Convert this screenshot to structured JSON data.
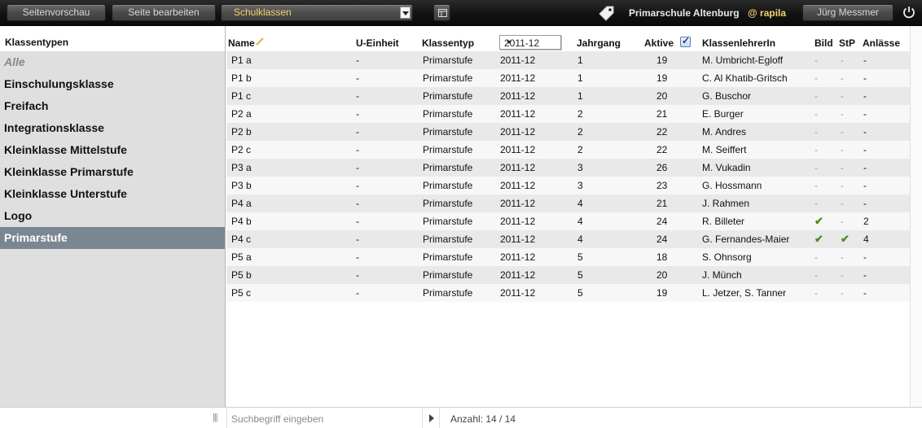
{
  "toolbar": {
    "preview_label": "Seitenvorschau",
    "edit_label": "Seite bearbeiten",
    "section_select_value": "Schulklassen",
    "school_name": "Primarschule Altenburg",
    "user_handle": "@ rapila",
    "user_name": "Jürg Messmer",
    "accent_color": "#f1d36e"
  },
  "sidebar": {
    "title": "Klassentypen",
    "items": [
      {
        "label": "Alle"
      },
      {
        "label": "Einschulungsklasse"
      },
      {
        "label": "Freifach"
      },
      {
        "label": "Integrationsklasse"
      },
      {
        "label": "Kleinklasse Mittelstufe"
      },
      {
        "label": "Kleinklasse Primarstufe"
      },
      {
        "label": "Kleinklasse Unterstufe"
      },
      {
        "label": "Logo"
      },
      {
        "label": "Primarstufe"
      }
    ],
    "active_index": 8
  },
  "table": {
    "headers": {
      "name": "Name",
      "unit": "U-Einheit",
      "type": "Klassentyp",
      "year_select": "2011-12",
      "grade": "Jahrgang",
      "active": "Aktive",
      "teacher": "KlassenlehrerIn",
      "image": "Bild",
      "stp": "StP",
      "events": "Anlässe"
    },
    "rows": [
      {
        "name": "P1 a",
        "unit": "-",
        "type": "Primarstufe",
        "year": "2011-12",
        "grade": "1",
        "active": "19",
        "teacher": "M. Umbricht-Egloff",
        "image": "-",
        "stp": "-",
        "events": "-"
      },
      {
        "name": "P1 b",
        "unit": "-",
        "type": "Primarstufe",
        "year": "2011-12",
        "grade": "1",
        "active": "19",
        "teacher": "C. Al Khatib-Gritsch",
        "image": "-",
        "stp": "-",
        "events": "-"
      },
      {
        "name": "P1 c",
        "unit": "-",
        "type": "Primarstufe",
        "year": "2011-12",
        "grade": "1",
        "active": "20",
        "teacher": "G. Buschor",
        "image": "-",
        "stp": "-",
        "events": "-"
      },
      {
        "name": "P2 a",
        "unit": "-",
        "type": "Primarstufe",
        "year": "2011-12",
        "grade": "2",
        "active": "21",
        "teacher": "E. Burger",
        "image": "-",
        "stp": "-",
        "events": "-"
      },
      {
        "name": "P2 b",
        "unit": "-",
        "type": "Primarstufe",
        "year": "2011-12",
        "grade": "2",
        "active": "22",
        "teacher": "M. Andres",
        "image": "-",
        "stp": "-",
        "events": "-"
      },
      {
        "name": "P2 c",
        "unit": "-",
        "type": "Primarstufe",
        "year": "2011-12",
        "grade": "2",
        "active": "22",
        "teacher": "M. Seiffert",
        "image": "-",
        "stp": "-",
        "events": "-"
      },
      {
        "name": "P3 a",
        "unit": "-",
        "type": "Primarstufe",
        "year": "2011-12",
        "grade": "3",
        "active": "26",
        "teacher": "M. Vukadin",
        "image": "-",
        "stp": "-",
        "events": "-"
      },
      {
        "name": "P3 b",
        "unit": "-",
        "type": "Primarstufe",
        "year": "2011-12",
        "grade": "3",
        "active": "23",
        "teacher": "G. Hossmann",
        "image": "-",
        "stp": "-",
        "events": "-"
      },
      {
        "name": "P4 a",
        "unit": "-",
        "type": "Primarstufe",
        "year": "2011-12",
        "grade": "4",
        "active": "21",
        "teacher": "J. Rahmen",
        "image": "-",
        "stp": "-",
        "events": "-"
      },
      {
        "name": "P4 b",
        "unit": "-",
        "type": "Primarstufe",
        "year": "2011-12",
        "grade": "4",
        "active": "24",
        "teacher": "R. Billeter",
        "image": "✔",
        "stp": "-",
        "events": "2"
      },
      {
        "name": "P4 c",
        "unit": "-",
        "type": "Primarstufe",
        "year": "2011-12",
        "grade": "4",
        "active": "24",
        "teacher": "G. Fernandes-Maier",
        "image": "✔",
        "stp": "✔",
        "events": "4"
      },
      {
        "name": "P5 a",
        "unit": "-",
        "type": "Primarstufe",
        "year": "2011-12",
        "grade": "5",
        "active": "18",
        "teacher": "S. Ohnsorg",
        "image": "-",
        "stp": "-",
        "events": "-"
      },
      {
        "name": "P5 b",
        "unit": "-",
        "type": "Primarstufe",
        "year": "2011-12",
        "grade": "5",
        "active": "20",
        "teacher": "J. Münch",
        "image": "-",
        "stp": "-",
        "events": "-"
      },
      {
        "name": "P5 c",
        "unit": "-",
        "type": "Primarstufe",
        "year": "2011-12",
        "grade": "5",
        "active": "19",
        "teacher": "L. Jetzer, S. Tanner",
        "image": "-",
        "stp": "-",
        "events": "-"
      }
    ]
  },
  "footer": {
    "search_placeholder": "Suchbegriff eingeben",
    "count_text": "Anzahl: 14 / 14"
  }
}
